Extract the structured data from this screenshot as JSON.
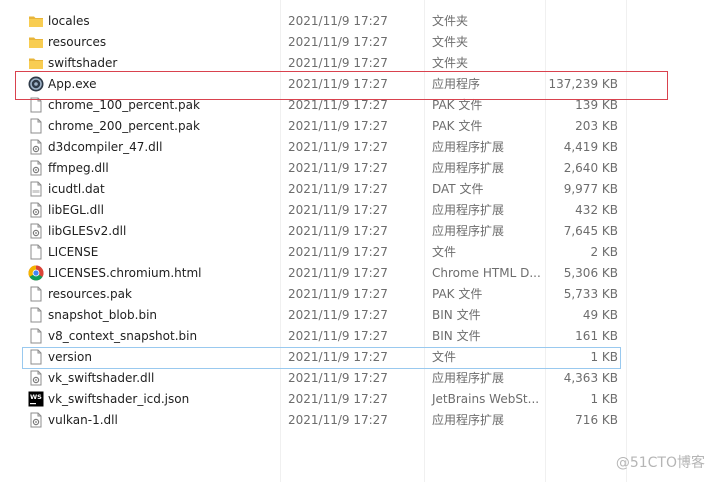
{
  "colors": {
    "highlight_border": "#d9424e",
    "focus_border": "#99c9ef",
    "folder": "#f5c242",
    "secondary_text": "#6d6d6d"
  },
  "files": [
    {
      "name": "locales",
      "date": "2021/11/9 17:27",
      "type": "文件夹",
      "size": "",
      "icon": "folder-icon"
    },
    {
      "name": "resources",
      "date": "2021/11/9 17:27",
      "type": "文件夹",
      "size": "",
      "icon": "folder-icon"
    },
    {
      "name": "swiftshader",
      "date": "2021/11/9 17:27",
      "type": "文件夹",
      "size": "",
      "icon": "folder-icon"
    },
    {
      "name": "App.exe",
      "date": "2021/11/9 17:27",
      "type": "应用程序",
      "size": "137,239 KB",
      "icon": "app-exe-icon"
    },
    {
      "name": "chrome_100_percent.pak",
      "date": "2021/11/9 17:27",
      "type": "PAK 文件",
      "size": "139 KB",
      "icon": "file-icon"
    },
    {
      "name": "chrome_200_percent.pak",
      "date": "2021/11/9 17:27",
      "type": "PAK 文件",
      "size": "203 KB",
      "icon": "file-icon"
    },
    {
      "name": "d3dcompiler_47.dll",
      "date": "2021/11/9 17:27",
      "type": "应用程序扩展",
      "size": "4,419 KB",
      "icon": "dll-icon"
    },
    {
      "name": "ffmpeg.dll",
      "date": "2021/11/9 17:27",
      "type": "应用程序扩展",
      "size": "2,640 KB",
      "icon": "dll-icon"
    },
    {
      "name": "icudtl.dat",
      "date": "2021/11/9 17:27",
      "type": "DAT 文件",
      "size": "9,977 KB",
      "icon": "dat-file-icon"
    },
    {
      "name": "libEGL.dll",
      "date": "2021/11/9 17:27",
      "type": "应用程序扩展",
      "size": "432 KB",
      "icon": "dll-icon"
    },
    {
      "name": "libGLESv2.dll",
      "date": "2021/11/9 17:27",
      "type": "应用程序扩展",
      "size": "7,645 KB",
      "icon": "dll-icon"
    },
    {
      "name": "LICENSE",
      "date": "2021/11/9 17:27",
      "type": "文件",
      "size": "2 KB",
      "icon": "file-icon"
    },
    {
      "name": "LICENSES.chromium.html",
      "date": "2021/11/9 17:27",
      "type": "Chrome HTML D...",
      "size": "5,306 KB",
      "icon": "chrome-icon"
    },
    {
      "name": "resources.pak",
      "date": "2021/11/9 17:27",
      "type": "PAK 文件",
      "size": "5,733 KB",
      "icon": "file-icon"
    },
    {
      "name": "snapshot_blob.bin",
      "date": "2021/11/9 17:27",
      "type": "BIN 文件",
      "size": "49 KB",
      "icon": "file-icon"
    },
    {
      "name": "v8_context_snapshot.bin",
      "date": "2021/11/9 17:27",
      "type": "BIN 文件",
      "size": "161 KB",
      "icon": "file-icon"
    },
    {
      "name": "version",
      "date": "2021/11/9 17:27",
      "type": "文件",
      "size": "1 KB",
      "icon": "file-icon"
    },
    {
      "name": "vk_swiftshader.dll",
      "date": "2021/11/9 17:27",
      "type": "应用程序扩展",
      "size": "4,363 KB",
      "icon": "dll-icon"
    },
    {
      "name": "vk_swiftshader_icd.json",
      "date": "2021/11/9 17:27",
      "type": "JetBrains WebSt...",
      "size": "1 KB",
      "icon": "webstorm-icon"
    },
    {
      "name": "vulkan-1.dll",
      "date": "2021/11/9 17:27",
      "type": "应用程序扩展",
      "size": "716 KB",
      "icon": "dll-icon"
    }
  ],
  "watermark": "@51CTO博客"
}
